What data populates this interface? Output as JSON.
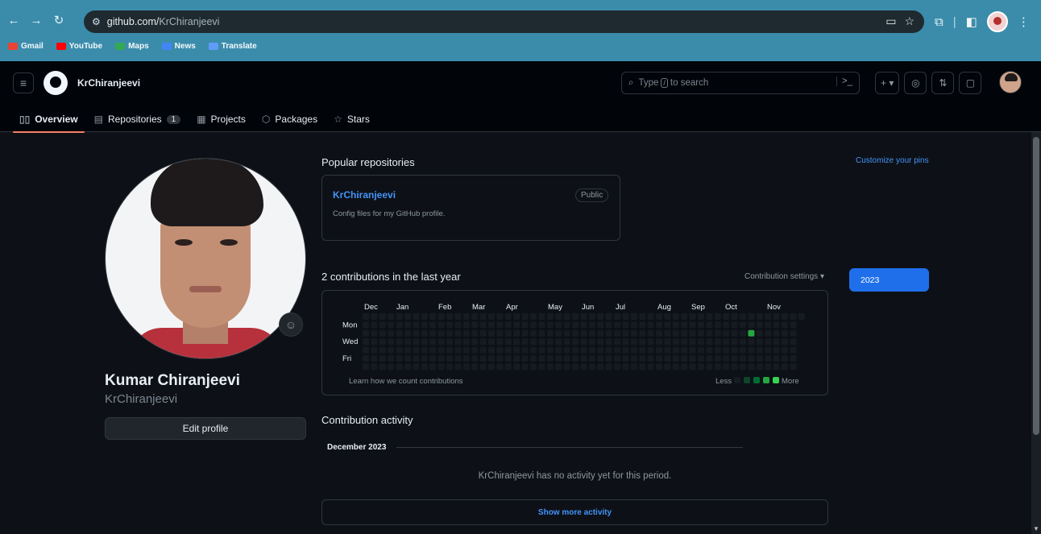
{
  "browser": {
    "url_host": "github.com/",
    "url_path": "KrChiranjeevi",
    "bookmarks": [
      "Gmail",
      "YouTube",
      "Maps",
      "News",
      "Translate"
    ]
  },
  "header": {
    "username": "KrChiranjeevi",
    "search_prefix": "Type",
    "search_key": "/",
    "search_suffix": "to search"
  },
  "tabs": [
    {
      "label": "Overview",
      "icon": "book-icon"
    },
    {
      "label": "Repositories",
      "icon": "repo-icon",
      "count": "1"
    },
    {
      "label": "Projects",
      "icon": "table-icon"
    },
    {
      "label": "Packages",
      "icon": "package-icon"
    },
    {
      "label": "Stars",
      "icon": "star-icon"
    }
  ],
  "profile": {
    "name": "Kumar Chiranjeevi",
    "login": "KrChiranjeevi",
    "edit_label": "Edit profile"
  },
  "popular": {
    "title": "Popular repositories",
    "customize": "Customize your pins",
    "repos": [
      {
        "name": "KrChiranjeevi",
        "badge": "Public",
        "desc": "Config files for my GitHub profile."
      }
    ]
  },
  "contributions": {
    "title": "2 contributions in the last year",
    "settings": "Contribution settings ▾",
    "year": "2023",
    "months": [
      "Dec",
      "Jan",
      "Feb",
      "Mar",
      "Apr",
      "May",
      "Jun",
      "Jul",
      "Aug",
      "Sep",
      "Oct",
      "Nov"
    ],
    "days": [
      "Mon",
      "Wed",
      "Fri"
    ],
    "learn": "Learn how we count contributions",
    "less": "Less",
    "more": "More",
    "weeks": 53,
    "active_cells": [
      {
        "week": 46,
        "day": 2,
        "level": 3
      }
    ],
    "level_colors": [
      "#161b22",
      "#0e4429",
      "#006d32",
      "#26a641",
      "#39d353"
    ]
  },
  "activity": {
    "title": "Contribution activity",
    "month": "December 2023",
    "empty": "KrChiranjeevi has no activity yet for this period.",
    "show_more": "Show more activity"
  }
}
